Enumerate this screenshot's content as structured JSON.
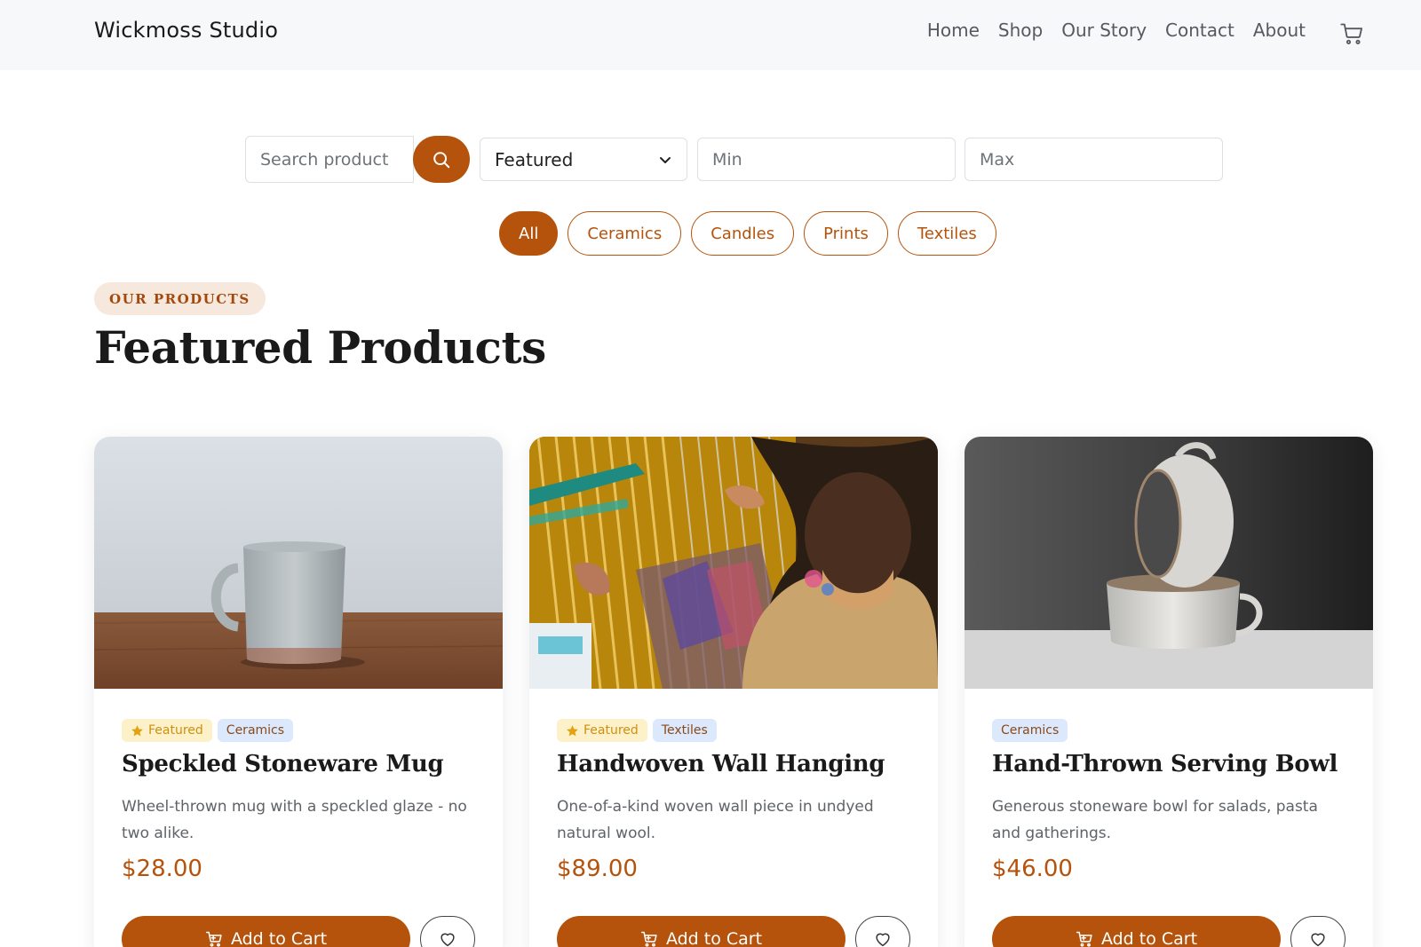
{
  "header": {
    "brand": "Wickmoss Studio",
    "nav": [
      "Home",
      "Shop",
      "Our Story",
      "Contact",
      "About"
    ],
    "cart_icon": "cart-icon"
  },
  "filters": {
    "search_placeholder": "Search product",
    "search_icon": "search-icon",
    "sort_value": "Featured",
    "min_placeholder": "Min",
    "max_placeholder": "Max",
    "categories": [
      "All",
      "Ceramics",
      "Candles",
      "Prints",
      "Textiles"
    ],
    "active_category": "All"
  },
  "section": {
    "eyebrow": "OUR PRODUCTS",
    "title": "Featured Products"
  },
  "products": [
    {
      "featured_label": "Featured",
      "category": "Ceramics",
      "name": "Speckled Stoneware Mug",
      "description": "Wheel-thrown mug with a speckled glaze - no two alike.",
      "price": "$28.00",
      "add_label": "Add to Cart"
    },
    {
      "featured_label": "Featured",
      "category": "Textiles",
      "name": "Handwoven Wall Hanging",
      "description": "One-of-a-kind woven wall piece in undyed natural wool.",
      "price": "$89.00",
      "add_label": "Add to Cart"
    },
    {
      "category": "Ceramics",
      "name": "Hand-Thrown Serving Bowl",
      "description": "Generous stoneware bowl for salads, pasta and gatherings.",
      "price": "$46.00",
      "add_label": "Add to Cart"
    }
  ],
  "colors": {
    "accent": "#b5530c",
    "header_bg": "#f7f8fa",
    "featured_tag_bg": "#fdf1c9",
    "category_tag_bg": "#dce8fb"
  }
}
